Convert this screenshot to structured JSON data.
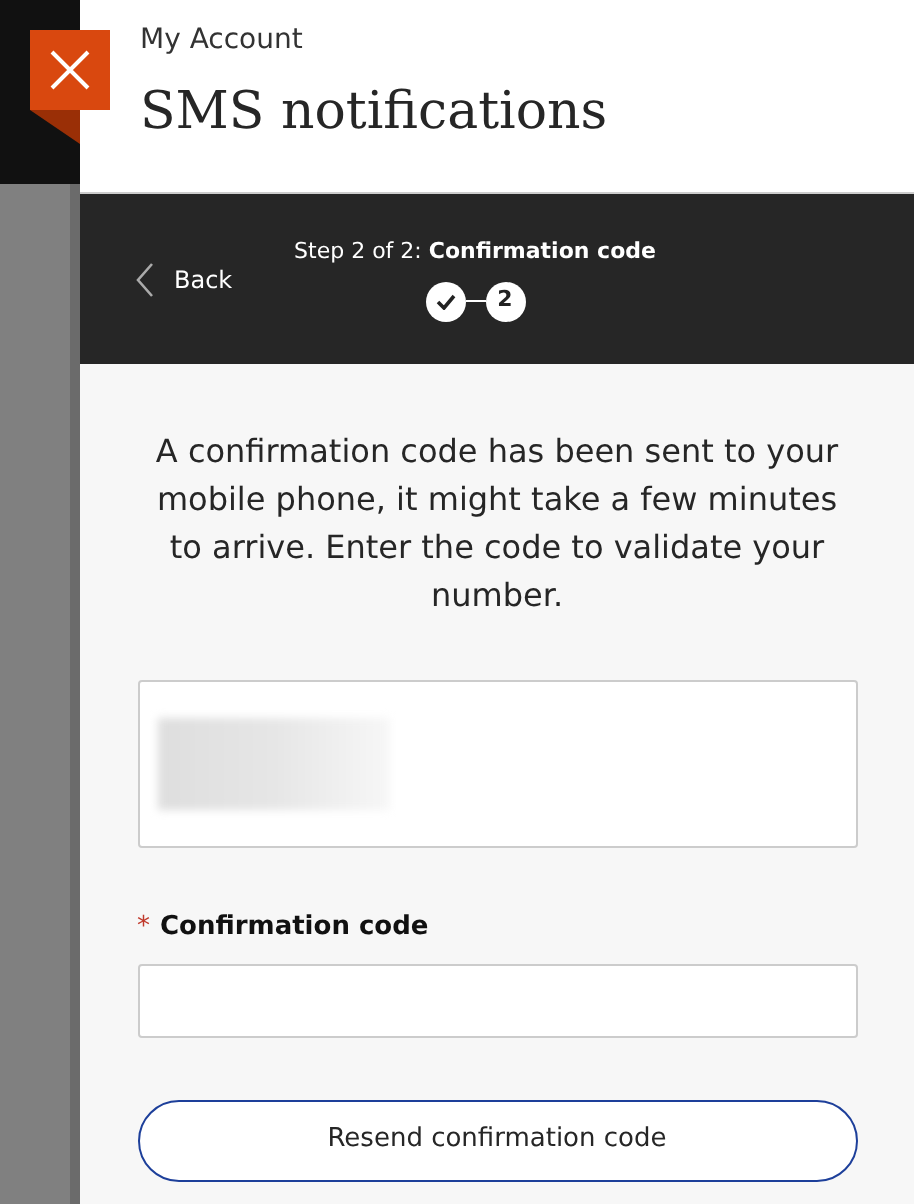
{
  "header": {
    "breadcrumb": "My Account",
    "title": "SMS notifications"
  },
  "stepper": {
    "back": "Back",
    "caption": "Step 2 of 2: **Confirmation code**",
    "steps": [
      {
        "kind": "done"
      },
      {
        "kind": "current",
        "label": "2"
      }
    ]
  },
  "message": "A confirmation code has been sent to your mobile phone, it might take a few minutes to arrive. Enter the code to validate your number.",
  "field": {
    "label": "Confirmation code",
    "required": true,
    "required_mark": "*"
  },
  "button": "Resend confirmation code"
}
